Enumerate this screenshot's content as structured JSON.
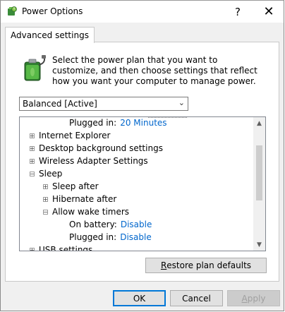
{
  "window": {
    "title": "Power Options",
    "help_glyph": "?",
    "close_glyph": "✕",
    "icon": "power-options-icon"
  },
  "tab": {
    "label": "Advanced settings"
  },
  "description": "Select the power plan that you want to customize, and then choose settings that reflect how you want your computer to manage power.",
  "plan_select": {
    "value": "Balanced [Active]"
  },
  "tree": {
    "plugged_in_top": {
      "label": "Plugged in:",
      "value": "20 Minutes"
    },
    "internet_explorer": "Internet Explorer",
    "desktop_background": "Desktop background settings",
    "wireless_adapter": "Wireless Adapter Settings",
    "sleep": "Sleep",
    "sleep_after": "Sleep after",
    "hibernate_after": "Hibernate after",
    "allow_wake_timers": "Allow wake timers",
    "on_battery": {
      "label": "On battery:",
      "value": "Disable"
    },
    "plugged_in": {
      "label": "Plugged in:",
      "value": "Disable"
    },
    "usb_settings": "USB settings"
  },
  "buttons": {
    "restore_prefix": "",
    "restore_accel": "R",
    "restore_rest": "estore plan defaults",
    "ok": "OK",
    "cancel": "Cancel",
    "apply_accel": "A",
    "apply_rest": "pply"
  },
  "colors": {
    "link_value": "#0066cc",
    "focus_border": "#0078d7"
  }
}
